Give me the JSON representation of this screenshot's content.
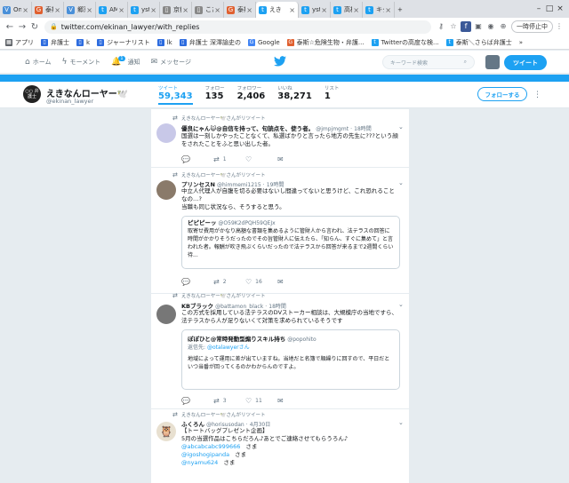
{
  "browser": {
    "tabs": [
      {
        "label": "One",
        "icon": "V",
        "color": "#4a90d9",
        "active": false
      },
      {
        "label": "泰斯",
        "icon": "G",
        "color": "#e06030",
        "active": false
      },
      {
        "label": "郷恵",
        "icon": "V",
        "color": "#4a90d9",
        "active": false
      },
      {
        "label": "AMA",
        "icon": "t",
        "color": "#1da1f2",
        "active": false
      },
      {
        "label": "ysti",
        "icon": "t",
        "color": "#1da1f2",
        "active": false
      },
      {
        "label": "京都",
        "icon": "▯",
        "color": "#888888",
        "active": false
      },
      {
        "label": "こた",
        "icon": "▯",
        "color": "#888888",
        "active": false
      },
      {
        "label": "泰斯",
        "icon": "G",
        "color": "#e06030",
        "active": false
      },
      {
        "label": "えき",
        "icon": "t",
        "color": "#1da1f2",
        "active": true
      },
      {
        "label": "ysti",
        "icon": "t",
        "color": "#1da1f2",
        "active": false
      },
      {
        "label": "高橋",
        "icon": "t",
        "color": "#1da1f2",
        "active": false
      },
      {
        "label": "キク",
        "icon": "t",
        "color": "#1da1f2",
        "active": false
      }
    ],
    "new_tab": "+",
    "url": "twitter.com/ekinan_lawyer/with_replies",
    "pause_label": "一時停止中",
    "bookmarks": [
      {
        "label": "アプリ",
        "color": "#5f6368",
        "icon": "▦"
      },
      {
        "label": "弁護士",
        "color": "#2d6cdf",
        "icon": "▯"
      },
      {
        "label": "k",
        "color": "#2d6cdf",
        "icon": "▯"
      },
      {
        "label": "ジャーナリスト",
        "color": "#2d6cdf",
        "icon": "▯"
      },
      {
        "label": "lk",
        "color": "#2d6cdf",
        "icon": "▯"
      },
      {
        "label": "弁護士 深澤諭史の",
        "color": "#2d6cdf",
        "icon": "▯"
      },
      {
        "label": "Google",
        "color": "#4285f4",
        "icon": "G"
      },
      {
        "label": "泰斯☆危険生物・弁護...",
        "color": "#e06030",
        "icon": "G"
      },
      {
        "label": "Twitterの高度な検...",
        "color": "#1da1f2",
        "icon": "t"
      },
      {
        "label": "泰斯＼さらば弁護士",
        "color": "#1da1f2",
        "icon": "t"
      }
    ],
    "more_bookmarks": "»"
  },
  "twitter_nav": {
    "home": "ホーム",
    "moments": "モーメント",
    "notifications": "通知",
    "notification_count": "1",
    "messages": "メッセージ",
    "search_placeholder": "キーワード検索",
    "tweet_button": "ツイート"
  },
  "profile": {
    "name": "えきなんローヤー🕊️",
    "handle": "@ekinan_lawyer",
    "avatar_text": "○○ 弁護士",
    "stats": [
      {
        "label": "ツイート",
        "value": "59,343",
        "active": true
      },
      {
        "label": "フォロー",
        "value": "135",
        "active": false
      },
      {
        "label": "フォロワー",
        "value": "2,406",
        "active": false
      },
      {
        "label": "いいね",
        "value": "38,271",
        "active": false
      },
      {
        "label": "リスト",
        "value": "1",
        "active": false
      }
    ],
    "follow_button": "フォローする"
  },
  "tweets": [
    {
      "retweeted_by": "えきなんローヤー🕊️さんがリツイート",
      "name": "優良にゃん😺@自信を持って、句読点を、使う者。",
      "handle": "@jmpjmgmt",
      "time": "18時間",
      "body": "国選は一刻しかやったことなくて、私選ばかりと言ったら地方の先生に???という顔をされたことをふと思い出した者。",
      "reply": "",
      "retweets": "1",
      "likes": ""
    },
    {
      "retweeted_by": "えきなんローヤー🕊️さんがリツイート",
      "name": "プリンセスN",
      "handle": "@himmemi1215",
      "time": "19時間",
      "body": "中立人代理人が自腹を切る必要はないし間違ってないと思うけど、これ恐れることなの…?",
      "body2": "当職も同じ状況なら、そうすると思う。",
      "quote": {
        "name": "ピピピーッ",
        "handle": "@O59K2dPQH59QEJx",
        "text": "取寄せ費用がかなり高額な書類を集めるように管財人から言われ、法テラスの回答に時間がかかりそうだったのでその旨管財人に伝えたら、「知らん、すぐに集めて」と言われた者。報酬が吹き飛ぶくらいだったので法テラスから回答が来るまで2週間くらい待..."
      },
      "retweets": "2",
      "likes": "16"
    },
    {
      "retweeted_by": "えきなんローヤー🕊️さんがリツイート",
      "name": "KBブラック",
      "handle": "@battamon_black",
      "time": "18時間",
      "body": "この方式を採用している法テラスのDVストーカー相談は、大規模庁の当地ですら、法テラスから人が足りないくて対策を求められているそうです",
      "quote": {
        "name": "ぽぽひと@常時発動型煽りスキル持ち",
        "handle": "@popohito",
        "reply_to_prefix": "返信先: ",
        "reply_to": "@otalawyerさん",
        "text": "地域によって運用に差が出ていますね。当地だと名簿で順繰りに回すので、平日だといつ当番が回ってくるのかわからんのですよ。"
      },
      "retweets": "3",
      "likes": "11"
    },
    {
      "retweeted_by": "えきなんローヤー🕊️さんがリツイート",
      "name": "ふくろん",
      "handle": "@horisusodan",
      "time": "4月30日",
      "body": "【トートバッグプレゼント企画】",
      "body2": "5月の当選作品はこちらだろん♪あとでご連絡させてもらうろん♪",
      "mentions": [
        {
          "handle": "@abcabcabc999666",
          "suffix": "さま"
        },
        {
          "handle": "@igoshogipanda",
          "suffix": "さま"
        },
        {
          "handle": "@nyamu624",
          "suffix": "さま"
        }
      ],
      "retweets": "",
      "likes": ""
    }
  ]
}
